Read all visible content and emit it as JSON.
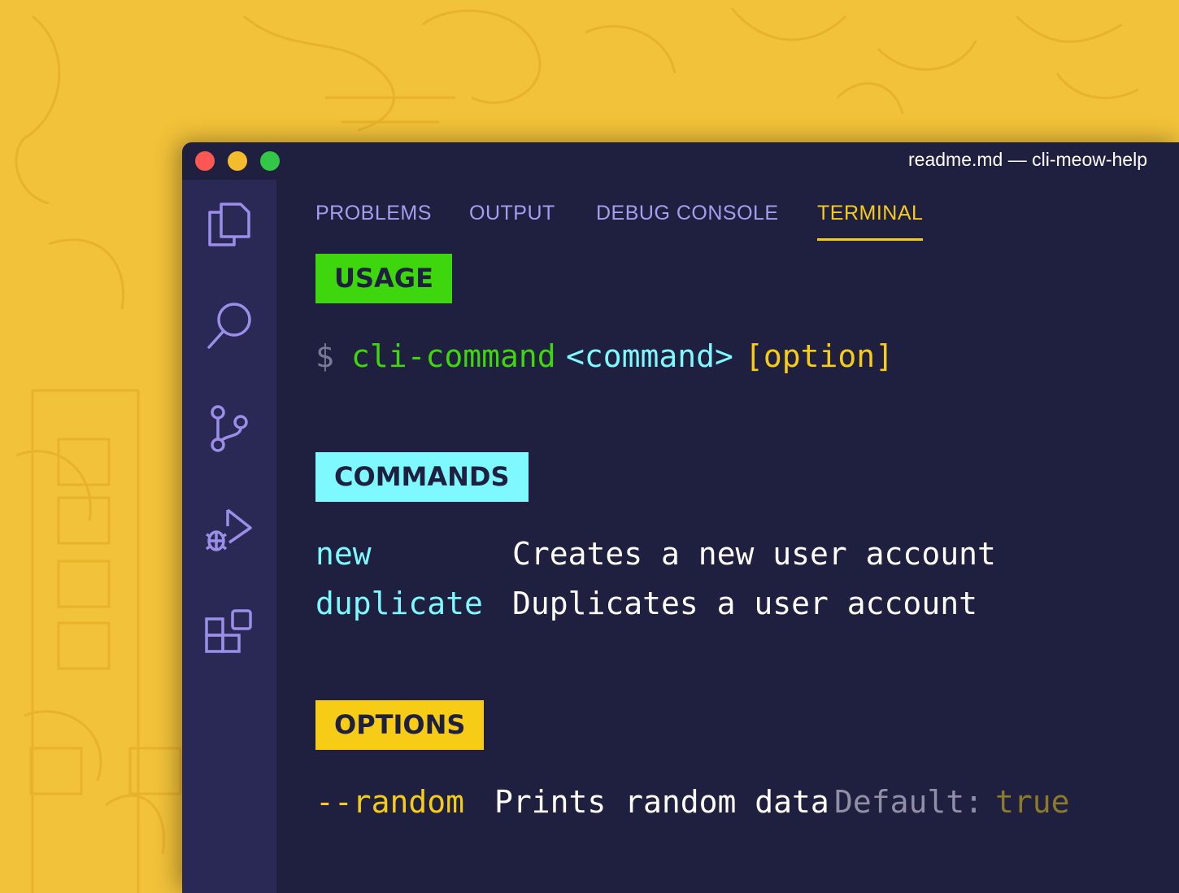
{
  "window": {
    "title": "readme.md — cli-meow-help"
  },
  "activity_bar": {
    "icons": [
      "explorer-icon",
      "search-icon",
      "source-control-icon",
      "run-debug-icon",
      "extensions-icon"
    ]
  },
  "panel": {
    "tabs": [
      {
        "label": "PROBLEMS",
        "active": false
      },
      {
        "label": "OUTPUT",
        "active": false
      },
      {
        "label": "DEBUG CONSOLE",
        "active": false
      },
      {
        "label": "TERMINAL",
        "active": true
      }
    ]
  },
  "terminal": {
    "usage": {
      "badge": "USAGE",
      "prompt": "$",
      "command": "cli-command",
      "arg": "<command>",
      "option": "[option]"
    },
    "commands": {
      "badge": "COMMANDS",
      "rows": [
        {
          "name": "new",
          "description": "Creates a new user account"
        },
        {
          "name": "duplicate",
          "description": "Duplicates a user account"
        }
      ]
    },
    "options": {
      "badge": "OPTIONS",
      "rows": [
        {
          "flag": "--random",
          "description": "Prints random data",
          "default_label": "Default:",
          "default_value": "true"
        }
      ]
    }
  },
  "colors": {
    "background": "#f2c23a",
    "window": "#1f1f3f",
    "activity_bar": "#2a2854",
    "accent_yellow": "#f7cc17",
    "usage_green": "#3ed60c",
    "commands_cyan": "#7ef9ff",
    "tab_text": "#a59df0"
  }
}
